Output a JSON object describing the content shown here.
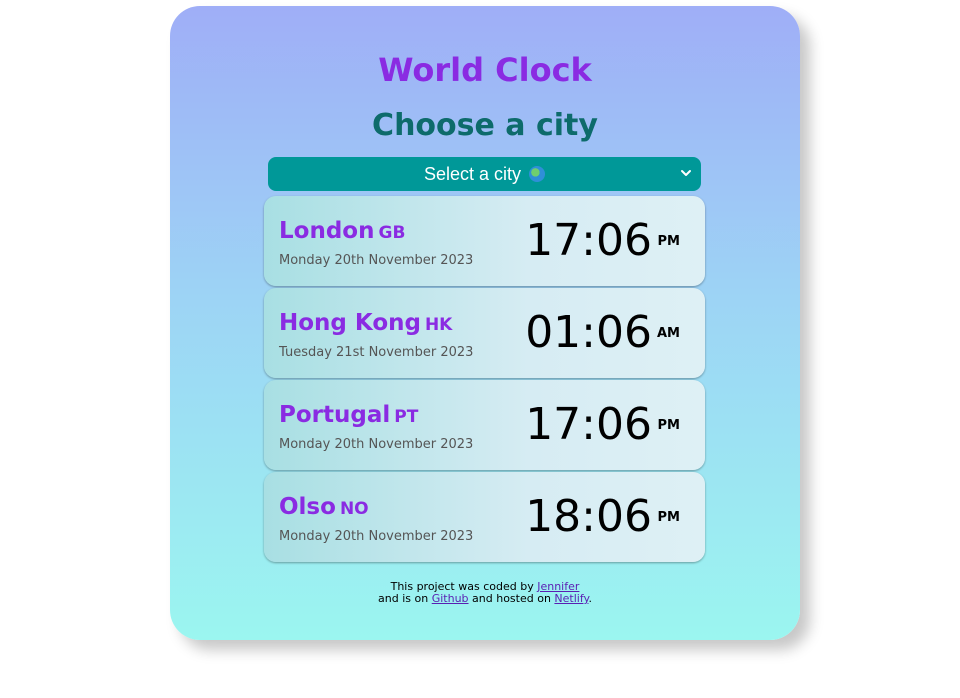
{
  "app": {
    "title": "World Clock",
    "subtitle": "Choose a city"
  },
  "city_select": {
    "selected_label": "Select a city",
    "icon": "globe-icon"
  },
  "cities": [
    {
      "name": "London",
      "code": "GB",
      "date": "Monday 20th November 2023",
      "time": "17:06",
      "ampm": "PM"
    },
    {
      "name": "Hong Kong",
      "code": "HK",
      "date": "Tuesday 21st November 2023",
      "time": "01:06",
      "ampm": "AM"
    },
    {
      "name": "Portugal",
      "code": "PT",
      "date": "Monday 20th November 2023",
      "time": "17:06",
      "ampm": "PM"
    },
    {
      "name": "Olso",
      "code": "NO",
      "date": "Monday 20th November 2023",
      "time": "18:06",
      "ampm": "PM"
    }
  ],
  "footer": {
    "line1_prefix": "This project was coded by",
    "author_link": "Jennifer",
    "line2_prefix": "and is on",
    "github_link": "Github",
    "line2_middle": "and hosted on",
    "netlify_link": "Netlify",
    "line2_suffix": "."
  },
  "colors": {
    "title": "#8a2be2",
    "subtitle": "#0d6b6b",
    "select_bg": "#009898",
    "link": "#5a1fb3"
  }
}
